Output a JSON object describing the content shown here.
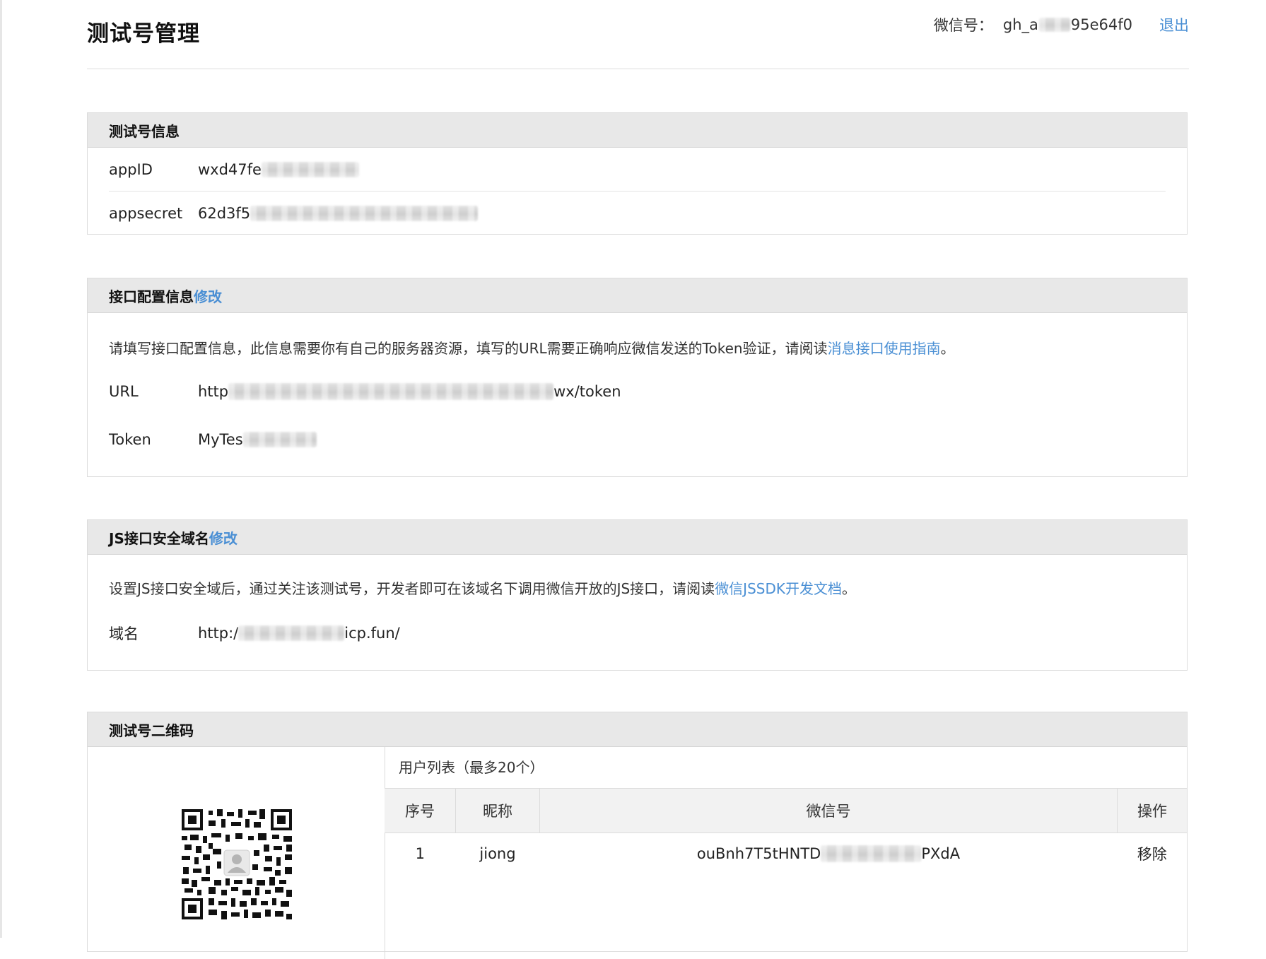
{
  "header": {
    "title": "测试号管理",
    "account_label": "微信号：",
    "account_prefix": "gh_a",
    "account_suffix": "95e64f0",
    "logout": "退出"
  },
  "info": {
    "title": "测试号信息",
    "rows": [
      {
        "key": "appID",
        "value": "wxd47fe"
      },
      {
        "key": "appsecret",
        "value": "62d3f5"
      }
    ]
  },
  "api": {
    "title": "接口配置信息",
    "edit": "修改",
    "desc_text": "请填写接口配置信息，此信息需要你有自己的服务器资源，填写的URL需要正确响应微信发送的Token验证，请阅读",
    "desc_link": "消息接口使用指南",
    "desc_end": "。",
    "url_key": "URL",
    "url_prefix": "http",
    "url_suffix": "wx/token",
    "token_key": "Token",
    "token_value": "MyTes"
  },
  "js": {
    "title": "JS接口安全域名",
    "edit": "修改",
    "desc_text": "设置JS接口安全域后，通过关注该测试号，开发者即可在该域名下调用微信开放的JS接口，请阅读",
    "desc_link": "微信JSSDK开发文档",
    "desc_end": "。",
    "domain_key": "域名",
    "domain_prefix": "http:/",
    "domain_suffix": "icp.fun/"
  },
  "qr": {
    "title": "测试号二维码",
    "user_list_title": "用户列表（最多20个）",
    "columns": [
      "序号",
      "昵称",
      "微信号",
      "操作"
    ],
    "rows": [
      {
        "index": "1",
        "nickname": "jiong",
        "wechat_prefix": "ouBnh7T5tHNTD",
        "wechat_suffix": "PXdA",
        "action": "移除"
      }
    ]
  },
  "colors": {
    "link": "#4a8fd4",
    "panel_header": "#e8e8e8",
    "border": "#dcdcdc"
  }
}
